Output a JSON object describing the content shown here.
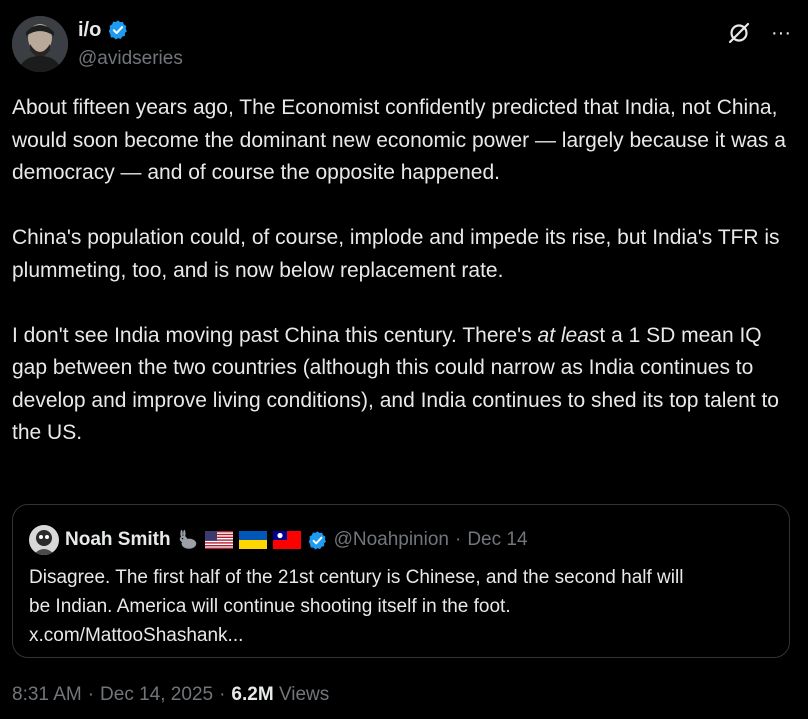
{
  "author": {
    "display_name": "i/o",
    "handle": "@avidseries",
    "verified_color": "#1d9bf0"
  },
  "header_actions": {
    "grok_icon": "grok-icon",
    "more": "···"
  },
  "tweet": {
    "para1": "About fifteen years ago, The Economist confidently predicted that India, not China, would soon become the dominant new economic power — largely because it was a democracy — and of course the opposite happened.",
    "para2": "China's population could, of course, implode and impede its rise, but India's TFR is plummeting, too, and is now below replacement rate.",
    "para3_a": "I don't see India moving past China this century. There's ",
    "para3_em": "at leas",
    "para3_b": "t a 1 SD mean IQ gap between the two countries (although this could narrow as India continues to develop and improve living conditions), and India continues to shed its top talent to the US."
  },
  "quote": {
    "display_name": "Noah Smith",
    "emojis": [
      "rabbit",
      "us-flag",
      "ukraine-flag",
      "taiwan-flag"
    ],
    "handle": "@Noahpinion",
    "separator": "·",
    "date": "Dec 14",
    "line1": "Disagree. The first half of the 21st century is Chinese, and the second half will",
    "line2": "be Indian. America will continue shooting itself in the foot.",
    "line3": "x.com/MattooShashank..."
  },
  "meta": {
    "time": "8:31 AM",
    "sep1": "·",
    "date": "Dec 14, 2025",
    "sep2": "·",
    "views_count": "6.2M",
    "views_label": "Views"
  }
}
